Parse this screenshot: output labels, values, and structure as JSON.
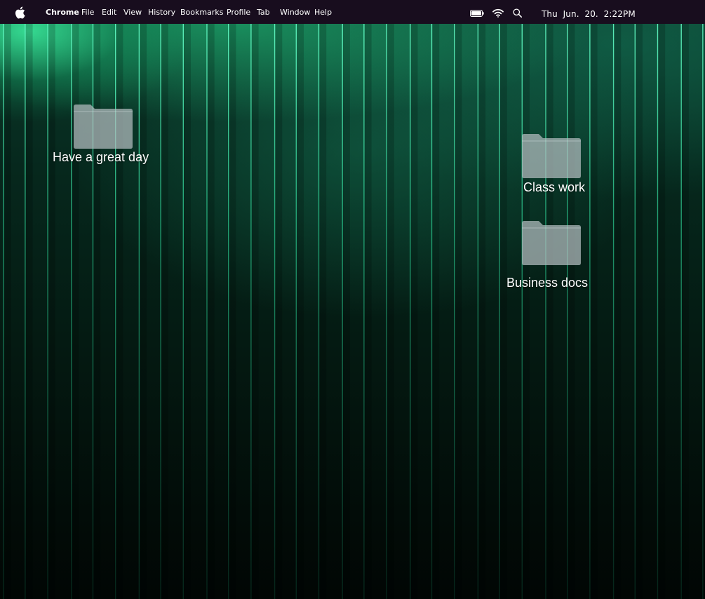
{
  "menubar": {
    "app_name": "Chrome",
    "items": [
      "File",
      "Edit",
      "View",
      "History",
      "Bookmarks",
      "Profile",
      "Tab",
      "Window",
      "Help"
    ],
    "status_icons": [
      "battery-icon",
      "wifi-icon",
      "search-icon"
    ],
    "clock": "Thu  Jun.  20.  2:22PM"
  },
  "desktop": {
    "folders": [
      {
        "label": "Have a great day",
        "icon": "folder-icon"
      },
      {
        "label": "Class work",
        "icon": "folder-icon"
      },
      {
        "label": "Business docs",
        "icon": "folder-icon"
      }
    ]
  },
  "colors": {
    "menubar_bg": "#180d1e",
    "wallpaper_accent": "#2ee8a0",
    "folder_fill": "#b4bec0"
  }
}
